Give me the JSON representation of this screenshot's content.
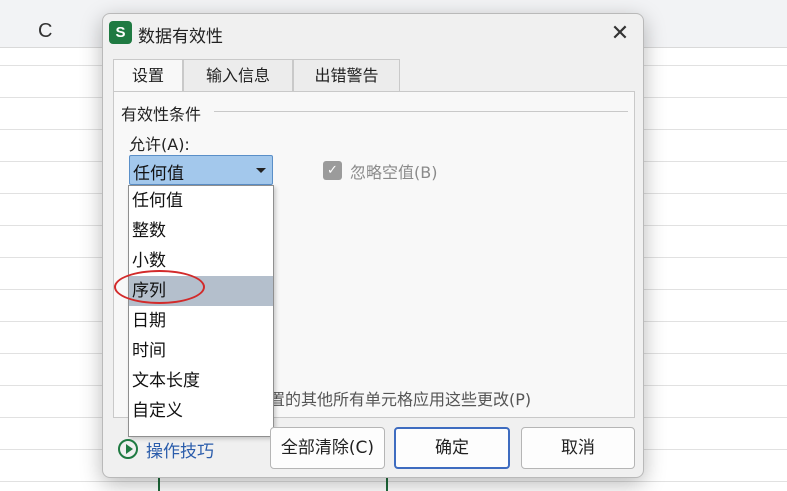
{
  "sheet": {
    "column_letter": "C"
  },
  "dialog": {
    "app_icon_letter": "S",
    "title": "数据有效性",
    "close_symbol": "✕",
    "tabs": [
      {
        "label": "设置",
        "active": true
      },
      {
        "label": "输入信息",
        "active": false
      },
      {
        "label": "出错警告",
        "active": false
      }
    ],
    "group_title": "有效性条件",
    "allow_label": "允许(A):",
    "allow_select": {
      "value": "任何值",
      "options": [
        "任何值",
        "整数",
        "小数",
        "序列",
        "日期",
        "时间",
        "文本长度",
        "自定义"
      ],
      "highlighted": "序列"
    },
    "ignore_blank": {
      "label": "忽略空值(B)",
      "checked": true,
      "enabled": false
    },
    "apply_to_all_text": "置的其他所有单元格应用这些更改(P)",
    "tips_label": "操作技巧",
    "buttons": {
      "clear_all": "全部清除(C)",
      "ok": "确定",
      "cancel": "取消"
    }
  },
  "colors": {
    "accent_green": "#1f7a42",
    "select_highlight": "#a3c8ec",
    "annotation_red": "#d22a2a",
    "link_blue": "#2a5cab"
  }
}
